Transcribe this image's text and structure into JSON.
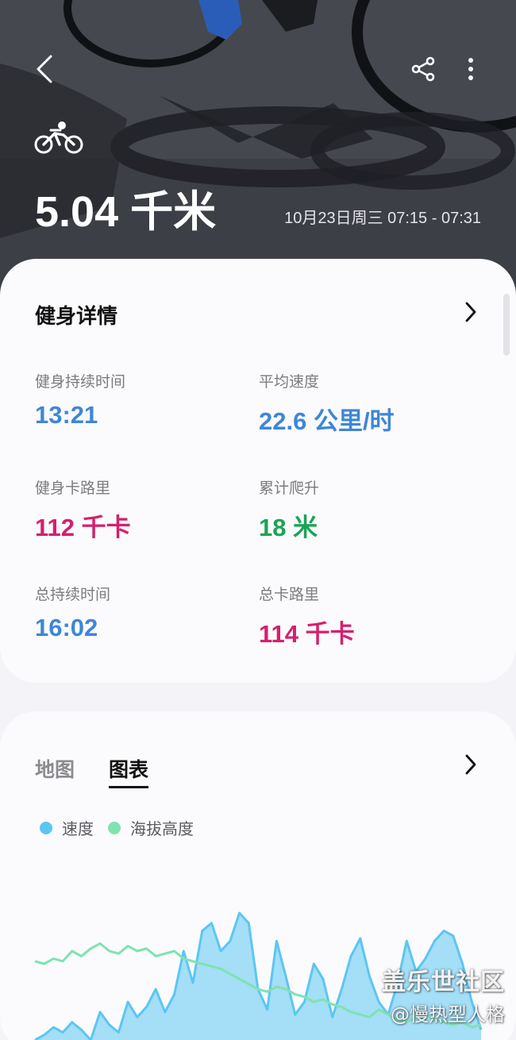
{
  "header": {
    "distance": "5.04 千米",
    "date_range": "10月23日周三 07:15 - 07:31"
  },
  "details": {
    "title": "健身详情",
    "metrics": [
      {
        "label": "健身持续时间",
        "value": "13:21",
        "color": "#3e86d7"
      },
      {
        "label": "平均速度",
        "value": "22.6 公里/时",
        "color": "#3e86d7"
      },
      {
        "label": "健身卡路里",
        "value": "112 千卡",
        "color": "#d4206e"
      },
      {
        "label": "累计爬升",
        "value": "18 米",
        "color": "#1aa455"
      },
      {
        "label": "总持续时间",
        "value": "16:02",
        "color": "#3e86d7"
      },
      {
        "label": "总卡路里",
        "value": "114 千卡",
        "color": "#d4206e"
      }
    ]
  },
  "chart_section": {
    "tabs": [
      "地图",
      "图表"
    ],
    "active_tab": "图表",
    "legend": [
      {
        "label": "速度",
        "color": "#5cc6f2"
      },
      {
        "label": "海拔高度",
        "color": "#7fe3b0"
      }
    ]
  },
  "chart_data": {
    "type": "area",
    "series": [
      {
        "name": "速度",
        "values": [
          0,
          4,
          10,
          6,
          14,
          8,
          0,
          22,
          12,
          6,
          30,
          18,
          26,
          40,
          22,
          36,
          70,
          45,
          86,
          92,
          70,
          78,
          100,
          92,
          40,
          24,
          78,
          50,
          20,
          30,
          60,
          48,
          18,
          40,
          66,
          80,
          50,
          30,
          20,
          44,
          78,
          54,
          64,
          78,
          86,
          82,
          60,
          30,
          8
        ]
      },
      {
        "name": "海拔高度",
        "values": [
          62,
          60,
          64,
          62,
          70,
          66,
          72,
          76,
          70,
          68,
          74,
          70,
          72,
          66,
          68,
          70,
          64,
          62,
          60,
          58,
          56,
          52,
          48,
          44,
          40,
          38,
          42,
          40,
          36,
          34,
          30,
          32,
          28,
          26,
          22,
          20,
          18,
          24,
          20,
          16,
          14,
          18,
          20,
          16,
          14,
          12,
          14,
          10,
          12
        ]
      }
    ]
  },
  "watermark": {
    "line1": "盖乐世社区",
    "line2": "@慢热型人格"
  }
}
